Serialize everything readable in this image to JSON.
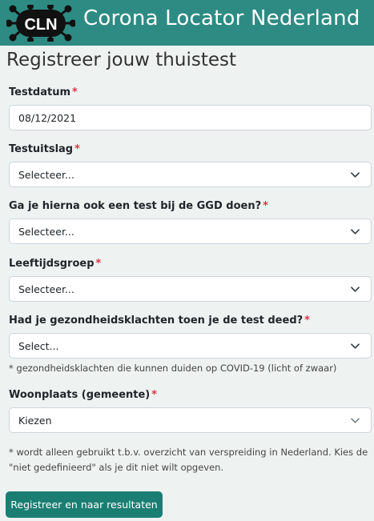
{
  "header": {
    "logo_text": "CLN",
    "title": "Corona Locator Nederland",
    "bg_color": "#2e8b83"
  },
  "form": {
    "title": "Registreer jouw thuistest",
    "required_mark": "*",
    "fields": [
      {
        "label": "Testdatum",
        "value": "08/12/2021",
        "type": "date"
      },
      {
        "label": "Testuitslag",
        "value": "Selecteer...",
        "type": "select"
      },
      {
        "label": "Ga je hierna ook een test bij de GGD doen?",
        "value": "Selecteer...",
        "type": "select"
      },
      {
        "label": "Leeftijdsgroep",
        "value": "Selecteer...",
        "type": "select"
      },
      {
        "label": "Had je gezondheidsklachten toen je de test deed?",
        "value": "Select...",
        "type": "select",
        "hint": "* gezondheidsklachten die kunnen duiden op COVID-19 (licht of zwaar)"
      },
      {
        "label": "Woonplaats (gemeente)",
        "value": "Kiezen",
        "type": "select",
        "hint": "* wordt alleen gebruikt t.b.v. overzicht van verspreiding in Nederland. Kies de \"niet gedefinieerd\" als je dit niet wilt opgeven."
      }
    ],
    "submit_label": "Registreer en naar resultaten",
    "accent_color": "#1b7e73",
    "required_color": "#dc3545"
  }
}
